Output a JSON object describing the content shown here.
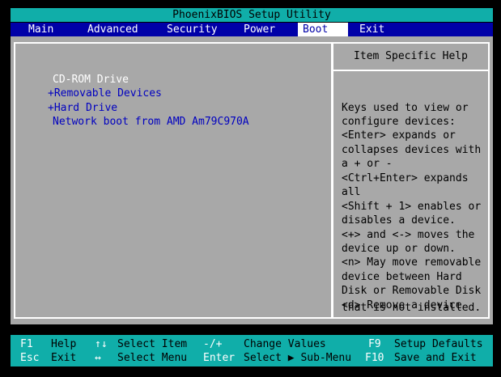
{
  "title": "PhoenixBIOS Setup Utility",
  "menu": {
    "tabs": [
      "Main",
      "Advanced",
      "Security",
      "Power",
      "Boot",
      "Exit"
    ],
    "active": "Boot"
  },
  "boot_list": [
    "CD-ROM Drive",
    "+Removable Devices",
    "+Hard Drive",
    "Network boot from AMD Am79C970A"
  ],
  "help": {
    "title": "Item Specific Help",
    "lines": [
      "Keys used to view or",
      "configure devices:",
      "<Enter> expands or",
      "collapses devices with",
      "a + or -",
      "<Ctrl+Enter> expands",
      "all",
      "<Shift + 1> enables or",
      "disables a device.",
      "<+> and <-> moves the",
      "device up or down.",
      "<n> May move removable",
      "device between Hard",
      "Disk or Removable Disk",
      "<d> Remove a device",
      "that is not installed."
    ]
  },
  "footer": {
    "row1": [
      {
        "key": "F1",
        "label": "Help"
      },
      {
        "key": "↑↓",
        "label": "Select Item"
      },
      {
        "key": "-/+",
        "label": "Change Values"
      },
      {
        "key": "F9",
        "label": "Setup Defaults"
      }
    ],
    "row2": [
      {
        "key": "Esc",
        "label": "Exit"
      },
      {
        "key": "↔",
        "label": "Select Menu"
      },
      {
        "key": "Enter",
        "label": "Select ▶ Sub-Menu"
      },
      {
        "key": "F10",
        "label": "Save and Exit"
      }
    ]
  }
}
